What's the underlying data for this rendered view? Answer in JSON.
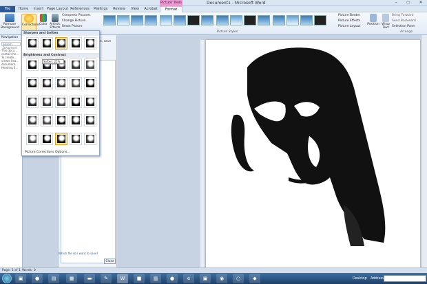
{
  "window": {
    "title": "Document1 - Microsoft Word",
    "context_tab_group": "Picture Tools",
    "controls": [
      "–",
      "▭",
      "✕"
    ]
  },
  "tabs": [
    "File",
    "Home",
    "Insert",
    "Page Layout",
    "References",
    "Mailings",
    "Review",
    "View",
    "Acrobat",
    "Format"
  ],
  "ribbon": {
    "remove_background": "Remove Background",
    "corrections": "Corrections",
    "color": "Color",
    "artistic_effects": "Artistic Effects",
    "compress": "Compress Pictures",
    "change": "Change Picture",
    "reset": "Reset Picture",
    "picture_styles_label": "Picture Styles",
    "picture_border": "Picture Border",
    "picture_effects": "Picture Effects",
    "picture_layout": "Picture Layout",
    "position": "Position",
    "wrap_text": "Wrap Text",
    "bring_forward": "Bring Forward",
    "send_backward": "Send Backward",
    "selection_pane": "Selection Pane",
    "arrange_label": "Arrange"
  },
  "nav_pane": {
    "title": "Navigation",
    "search_placeholder": "Search Document",
    "body": "This docu... contain he... To create... create hea... document... Heading S..."
  },
  "gallery": {
    "sharpen_header": "Sharpen and Soften",
    "brightness_header": "Brightness and Contrast",
    "tooltip": "Soften: 25%",
    "footer": "Picture Corrections Options..."
  },
  "mid_pane": {
    "side_text": "file, save",
    "help_link": "Which file do I want to save?",
    "close_button": "Close"
  },
  "status": {
    "page": "Page: 1 of 1",
    "words": "Words: 0"
  },
  "taskbar": {
    "desktop": "Desktop",
    "address": "Address"
  }
}
